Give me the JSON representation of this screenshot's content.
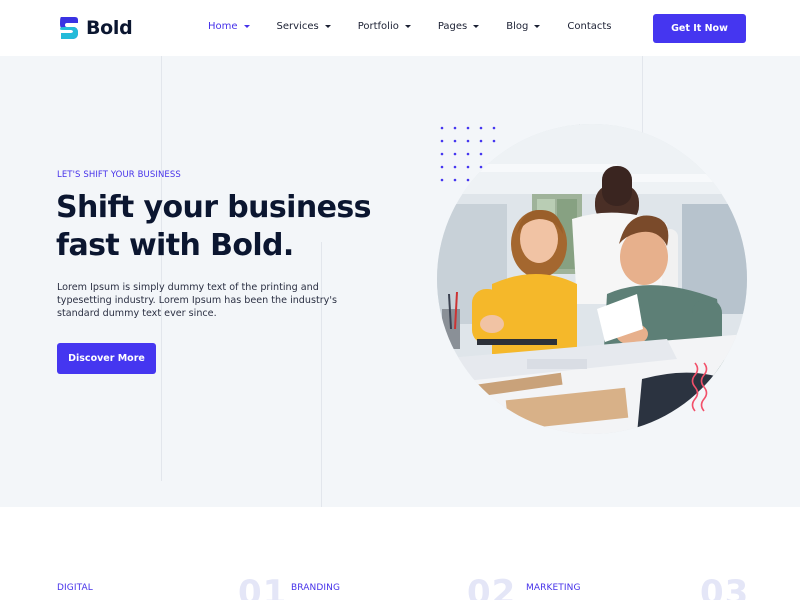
{
  "brand": {
    "name": "Bold",
    "logo_colors": [
      "#3a32e3",
      "#23c3d8"
    ]
  },
  "nav": {
    "items": [
      {
        "label": "Home",
        "has_dropdown": true,
        "active": true
      },
      {
        "label": "Services",
        "has_dropdown": true,
        "active": false
      },
      {
        "label": "Portfolio",
        "has_dropdown": true,
        "active": false
      },
      {
        "label": "Pages",
        "has_dropdown": true,
        "active": false
      },
      {
        "label": "Blog",
        "has_dropdown": true,
        "active": false
      },
      {
        "label": "Contacts",
        "has_dropdown": false,
        "active": false
      }
    ],
    "cta_label": "Get It Now"
  },
  "hero": {
    "eyebrow": "LET'S SHIFT YOUR BUSINESS",
    "headline_line1": "Shift your business",
    "headline_line2": "fast with Bold.",
    "description": "Lorem Ipsum is simply dummy text of the printing and typesetting industry. Lorem Ipsum has been the industry's standard dummy text ever since.",
    "button_label": "Discover More",
    "image_alt": "team-photo-icon"
  },
  "features": [
    {
      "label": "DIGITAL",
      "number": "01"
    },
    {
      "label": "BRANDING",
      "number": "02"
    },
    {
      "label": "MARKETING",
      "number": "03"
    }
  ],
  "colors": {
    "accent": "#4536f0",
    "hero_bg": "#f3f6f9",
    "heading": "#0b1630",
    "squiggle": "#f2506a"
  }
}
